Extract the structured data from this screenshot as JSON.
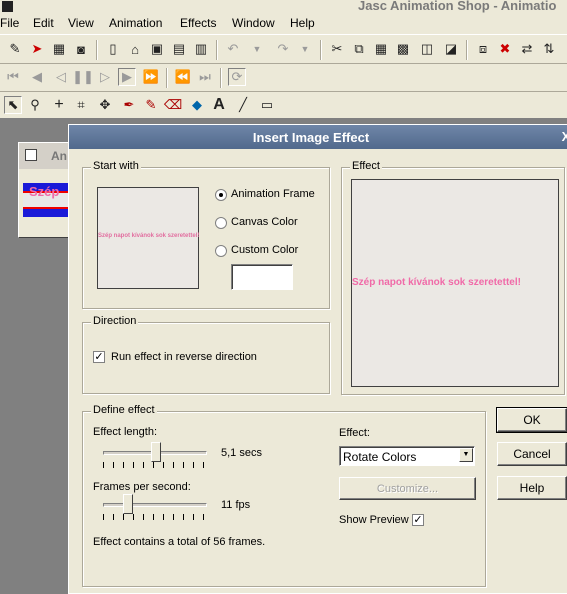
{
  "app": {
    "title": "Jasc Animation Shop - Animatio"
  },
  "menubar": [
    "File",
    "Edit",
    "View",
    "Animation",
    "Effects",
    "Window",
    "Help"
  ],
  "child_window": {
    "title": "An",
    "thumb_text": "Szép"
  },
  "dialog": {
    "title": "Insert Image Effect",
    "close_glyph": "X",
    "start_with": {
      "label": "Start with",
      "preview_text": "Szép napot kívánok sok szeretettel!",
      "options": [
        "Animation Frame",
        "Canvas Color",
        "Custom Color"
      ],
      "selected": "Animation Frame"
    },
    "effect_preview": {
      "label": "Effect",
      "preview_text": "Szép napot kívánok sok szeretettel!"
    },
    "direction": {
      "label": "Direction",
      "checkbox_label": "Run effect in reverse direction",
      "checked": true
    },
    "define_effect": {
      "label": "Define effect",
      "effect_length_label": "Effect length:",
      "effect_length_value": "5,1 secs",
      "fps_label": "Frames per second:",
      "fps_value": "11 fps",
      "summary": "Effect contains a total of 56 frames.",
      "effect_label": "Effect:",
      "effect_selected": "Rotate Colors",
      "customize_label": "Customize...",
      "show_preview_label": "Show Preview",
      "show_preview_checked": true
    },
    "buttons": {
      "ok": "OK",
      "cancel": "Cancel",
      "help": "Help"
    }
  },
  "icons": {
    "toolbar1": [
      "wizard-icon",
      "banner-icon",
      "film-icon",
      "camera-icon",
      "new-icon",
      "open-icon",
      "save-icon",
      "frames-icon",
      "properties-icon",
      "undo-icon",
      "redo-icon",
      "cut-icon",
      "copy-icon",
      "paste-icon",
      "paste-frames-icon",
      "paste-after-icon",
      "paste-before-icon",
      "resize-icon",
      "delete-icon",
      "mirror-icon",
      "flip-icon"
    ],
    "toolbar2": [
      "first-frame-icon",
      "prev-frame-icon",
      "step-back-icon",
      "pause-icon",
      "step-fwd-icon",
      "play-icon",
      "fast-forward-icon",
      "last-frame-icon",
      "next-icon",
      "loop-icon"
    ],
    "toolbar3": [
      "arrow-icon",
      "zoom-icon",
      "crosshair-icon",
      "crop-icon",
      "move-icon",
      "dropper-icon",
      "brush-icon",
      "eraser-icon",
      "fill-icon",
      "text-icon",
      "rectangle-icon"
    ]
  }
}
